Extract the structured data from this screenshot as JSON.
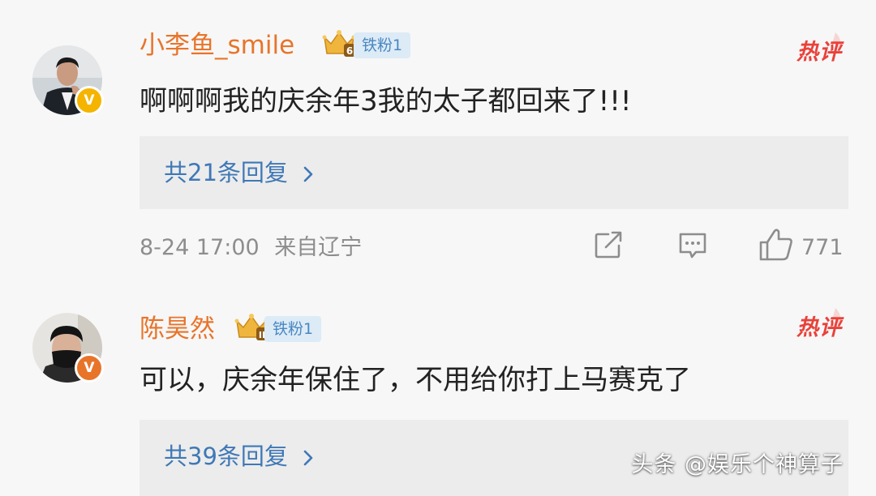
{
  "comments": [
    {
      "username": "小李鱼_smile",
      "fan_badge": "铁粉1",
      "crown_level": "6",
      "hot_label": "热评",
      "verified_mark": "V",
      "content": "啊啊啊我的庆余年3我的太子都回来了!!!",
      "reply_summary": "共21条回复",
      "timestamp": "8-24 17:00",
      "location": "来自辽宁",
      "like_count": "771"
    },
    {
      "username": "陈昊然",
      "fan_badge": "铁粉1",
      "crown_level": "II",
      "hot_label": "热评",
      "verified_mark": "V",
      "content": "可以，庆余年保住了，不用给你打上马赛克了",
      "reply_summary": "共39条回复"
    }
  ],
  "watermark": "头条 @娱乐个神算子",
  "colors": {
    "username": "#e8742a",
    "reply_link": "#3f78b6",
    "fan_badge_bg": "#dcebf6",
    "fan_badge_text": "#4a87c2",
    "hot": "#e9423a",
    "meta": "#8d8d8d",
    "verified": "#f5b400"
  },
  "icons": {
    "crown": "crown-icon",
    "verified": "verified-badge-icon",
    "repost": "repost-icon",
    "comment": "comment-icon",
    "like": "like-icon",
    "chevron": "chevron-right-icon"
  }
}
